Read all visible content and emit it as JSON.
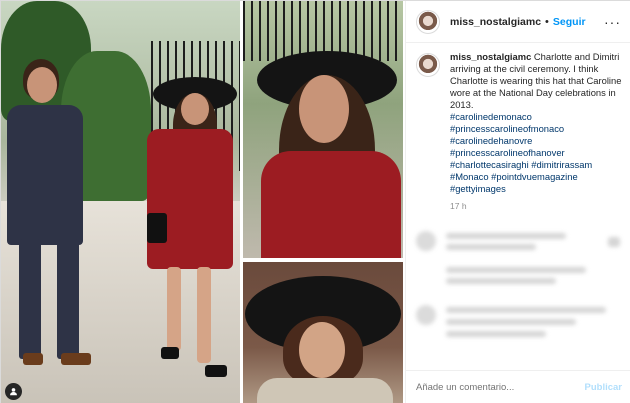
{
  "post": {
    "username": "miss_nostalgiamc",
    "follow_label": "Seguir",
    "separator": "•",
    "more_label": "···",
    "caption_text": "Charlotte and Dimitri arriving at the civil ceremony. I think Charlotte is wearing this hat that Caroline wore at the National Day celebrations in 2013.",
    "hashtags": [
      "#carolinedemonaco",
      "#princesscarolineofmonaco",
      "#carolinedehanovre",
      "#princesscarolineofhanover",
      "#charlottecasiraghi #dimitrirassam",
      "#Monaco #pointdvuemagazine",
      "#gettyimages"
    ],
    "time": "17 h"
  },
  "footer": {
    "comment_placeholder": "Añade un comentario...",
    "publish_label": "Publicar"
  },
  "icons": {
    "user_tag": "user-tag-icon",
    "more": "more-options-icon"
  },
  "colors": {
    "link_blue": "#0095f6",
    "hashtag": "#00376b",
    "publish_disabled": "#b2dffc",
    "dress_red": "#9c1c22"
  }
}
